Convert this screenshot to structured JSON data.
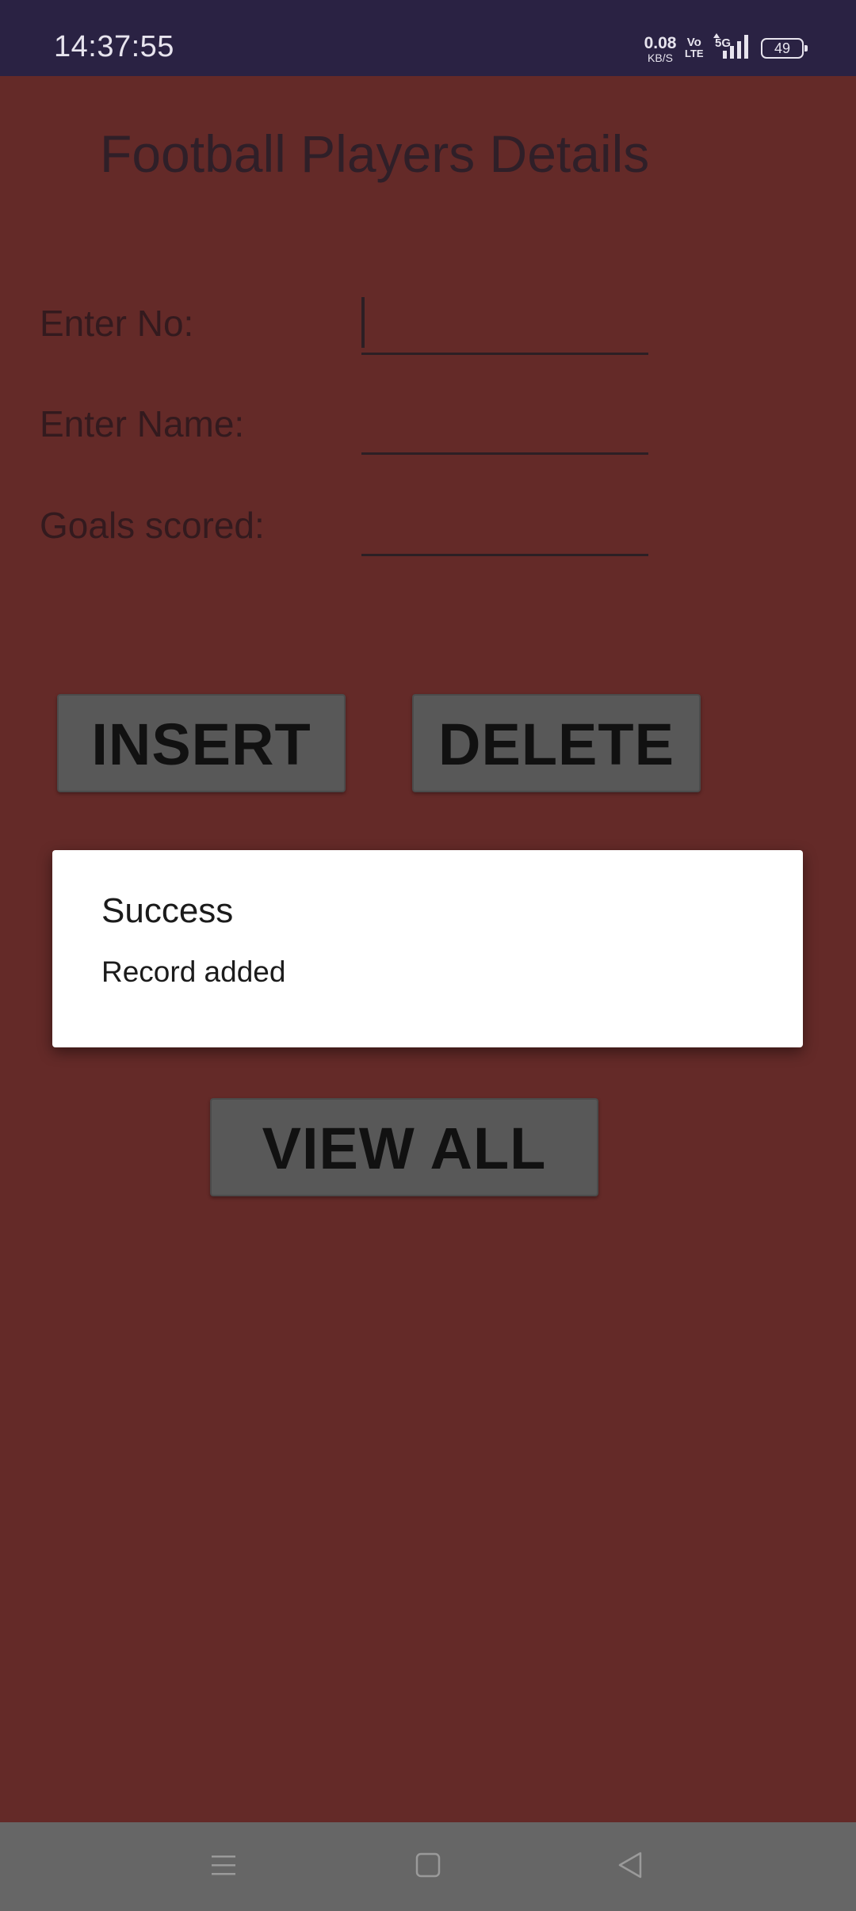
{
  "status_bar": {
    "time": "14:37:55",
    "net_speed_value": "0.08",
    "net_speed_unit": "KB/S",
    "volte_top": "Vo",
    "volte_bottom": "LTE",
    "network": "5G",
    "battery": "49",
    "icons": [
      "signal-icon",
      "battery-icon"
    ]
  },
  "page": {
    "title": "Football Players Details",
    "background_color": "#642a28"
  },
  "form": {
    "no_label": "Enter No:",
    "no_value": "",
    "name_label": "Enter Name:",
    "name_value": "",
    "goals_label": "Goals scored:",
    "goals_value": ""
  },
  "buttons": {
    "insert": "INSERT",
    "delete": "DELETE",
    "view_all": "VIEW ALL",
    "color": "#585858"
  },
  "dialog": {
    "title": "Success",
    "message": "Record added"
  },
  "nav_bar": {
    "icons": [
      "menu-icon",
      "home-icon",
      "back-icon"
    ]
  }
}
